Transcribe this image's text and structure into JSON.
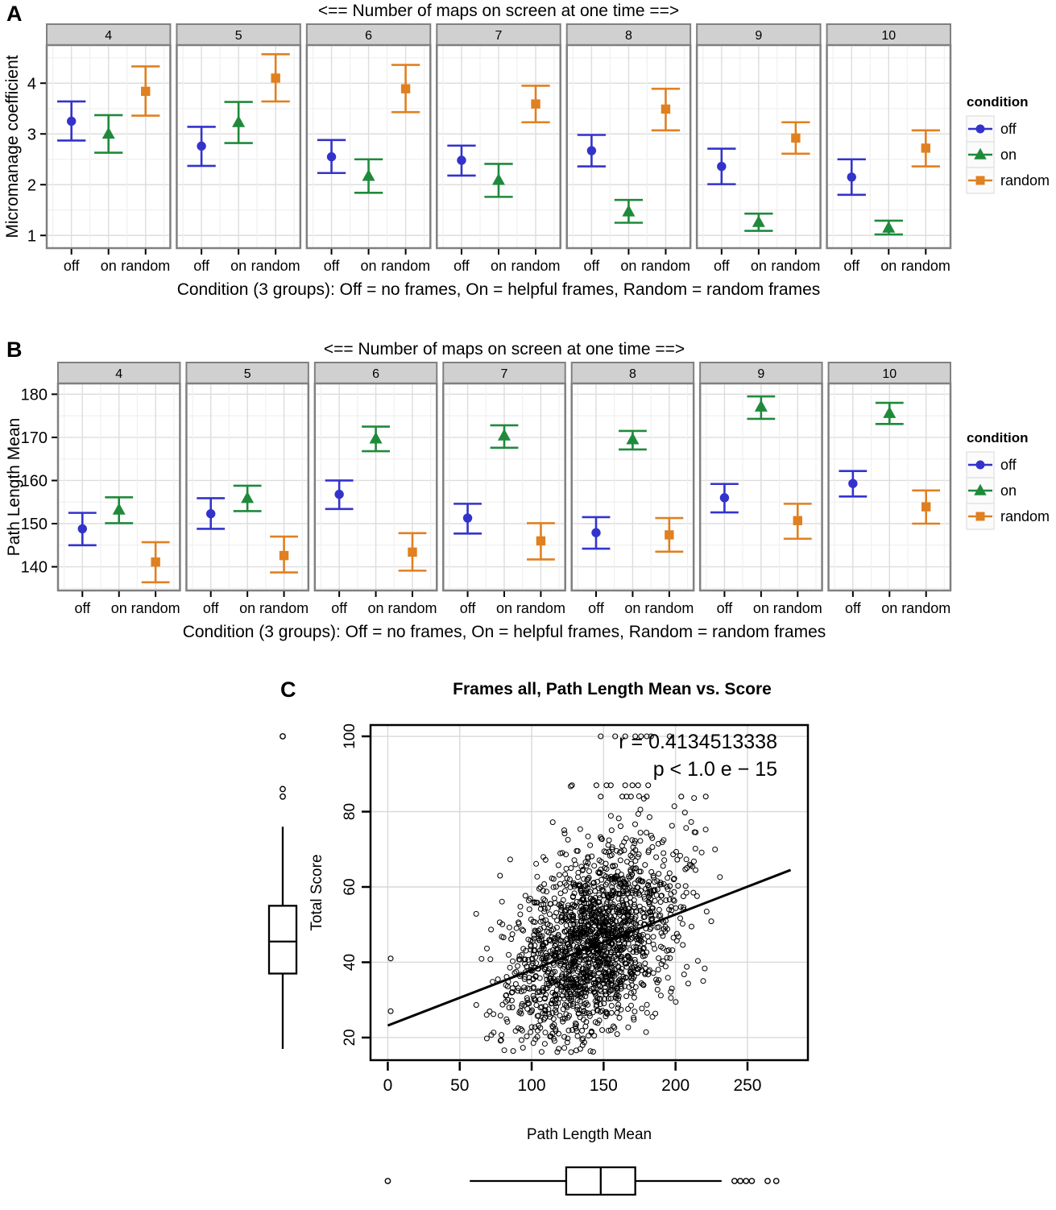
{
  "figure": {
    "panel_letters": [
      "A",
      "B",
      "C"
    ],
    "legend_title": "condition",
    "legend_items": [
      {
        "label": "off",
        "color": "#3333CC",
        "shape": "circle"
      },
      {
        "label": "on",
        "color": "#1F8A3B",
        "shape": "triangle"
      },
      {
        "label": "random",
        "color": "#E08020",
        "shape": "square"
      }
    ],
    "colors": {
      "off": "#3333CC",
      "on": "#1F8A3B",
      "random": "#E08020",
      "strip_fill": "#D0D0D0",
      "strip_border": "#808080",
      "panel_border": "#808080",
      "grid_major": "#DDDDDD",
      "grid_minor": "#F0F0F0"
    }
  },
  "chart_data": [
    {
      "id": "panel-a",
      "type": "scatter",
      "panel_letter": "A",
      "title": "<== Number of maps on screen at one time ==>",
      "ylabel": "Micromanage coefficient",
      "xlabel": "Condition (3 groups): Off = no frames, On = helpful frames, Random = random frames",
      "facet_label": "Number of maps on screen at one time",
      "facets": [
        "4",
        "5",
        "6",
        "7",
        "8",
        "9",
        "10"
      ],
      "xticks": [
        "off",
        "on",
        "random"
      ],
      "yticks": [
        1,
        2,
        3,
        4
      ],
      "ylim": [
        0.75,
        4.75
      ],
      "grid": true,
      "legend_position": "right",
      "series": [
        {
          "name": "off",
          "color": "#3333CC",
          "shape": "circle",
          "values": [
            3.25,
            2.76,
            2.55,
            2.48,
            2.67,
            2.36,
            2.15
          ],
          "lower": [
            2.87,
            2.37,
            2.23,
            2.18,
            2.36,
            2.01,
            1.8
          ],
          "upper": [
            3.64,
            3.14,
            2.88,
            2.77,
            2.98,
            2.71,
            2.5
          ]
        },
        {
          "name": "on",
          "color": "#1F8A3B",
          "shape": "triangle",
          "values": [
            3.0,
            3.23,
            2.17,
            2.09,
            1.47,
            1.26,
            1.15
          ],
          "lower": [
            2.63,
            2.82,
            1.84,
            1.76,
            1.25,
            1.09,
            1.02
          ],
          "upper": [
            3.37,
            3.63,
            2.5,
            2.41,
            1.7,
            1.43,
            1.29
          ]
        },
        {
          "name": "random",
          "color": "#E08020",
          "shape": "square",
          "values": [
            3.84,
            4.1,
            3.89,
            3.59,
            3.49,
            2.92,
            2.72
          ],
          "lower": [
            3.36,
            3.64,
            3.43,
            3.23,
            3.07,
            2.61,
            2.36
          ],
          "upper": [
            4.33,
            4.57,
            4.36,
            3.95,
            3.89,
            3.23,
            3.07
          ]
        }
      ]
    },
    {
      "id": "panel-b",
      "type": "scatter",
      "panel_letter": "B",
      "title": "<== Number of maps on screen at one time ==>",
      "ylabel": "Path Length Mean",
      "xlabel": "Condition (3 groups): Off = no frames, On = helpful frames, Random = random frames",
      "facet_label": "Number of maps on screen at one time",
      "facets": [
        "4",
        "5",
        "6",
        "7",
        "8",
        "9",
        "10"
      ],
      "xticks": [
        "off",
        "on",
        "random"
      ],
      "yticks": [
        140,
        150,
        160,
        170,
        180
      ],
      "ylim": [
        134.5,
        182.5
      ],
      "grid": true,
      "legend_position": "right",
      "series": [
        {
          "name": "off",
          "color": "#3333CC",
          "shape": "circle",
          "values": [
            148.8,
            152.3,
            156.8,
            151.3,
            147.9,
            156.0,
            159.3
          ],
          "lower": [
            145.0,
            148.8,
            153.4,
            147.7,
            144.2,
            152.6,
            156.3
          ],
          "upper": [
            152.5,
            155.9,
            160.0,
            154.6,
            151.5,
            159.2,
            162.2
          ]
        },
        {
          "name": "on",
          "color": "#1F8A3B",
          "shape": "triangle",
          "values": [
            153.2,
            155.9,
            169.7,
            170.4,
            169.5,
            177.1,
            175.6
          ],
          "lower": [
            150.1,
            152.9,
            166.8,
            167.6,
            167.2,
            174.3,
            173.1
          ],
          "upper": [
            156.1,
            158.8,
            172.5,
            172.8,
            171.5,
            179.5,
            178.0
          ]
        },
        {
          "name": "random",
          "color": "#E08020",
          "shape": "square",
          "values": [
            141.1,
            142.6,
            143.4,
            146.0,
            147.4,
            150.7,
            153.9
          ],
          "lower": [
            136.4,
            138.7,
            139.1,
            141.7,
            143.5,
            146.5,
            150.0
          ],
          "upper": [
            145.7,
            147.0,
            147.8,
            150.1,
            151.3,
            154.6,
            157.7
          ]
        }
      ]
    },
    {
      "id": "panel-c",
      "type": "scatter",
      "panel_letter": "C",
      "title": "Frames all, Path Length Mean vs. Score",
      "xlabel": "Path Length Mean",
      "ylabel": "Total Score",
      "xticks": [
        0,
        50,
        100,
        150,
        200,
        250
      ],
      "yticks": [
        20,
        40,
        60,
        80,
        100
      ],
      "xlim": [
        -12,
        292
      ],
      "ylim": [
        14,
        103
      ],
      "grid": true,
      "annotations": [
        {
          "text": "r = 0.4134513338"
        },
        {
          "text": "p < 1.0 e − 15"
        }
      ],
      "regression": {
        "x1": 0,
        "y1": 23.2,
        "x2": 280,
        "y2": 64.5
      },
      "n_points": 1800,
      "marginal_boxplot_y": {
        "min": 17,
        "q1": 37,
        "median": 45.5,
        "q3": 55,
        "max": 76,
        "outliers": [
          84,
          86,
          100
        ]
      },
      "marginal_boxplot_x": {
        "min": 57,
        "q1": 124,
        "median": 148,
        "q3": 172,
        "max": 232,
        "outliers": [
          0,
          241,
          245,
          249,
          253,
          264,
          270
        ]
      }
    }
  ]
}
